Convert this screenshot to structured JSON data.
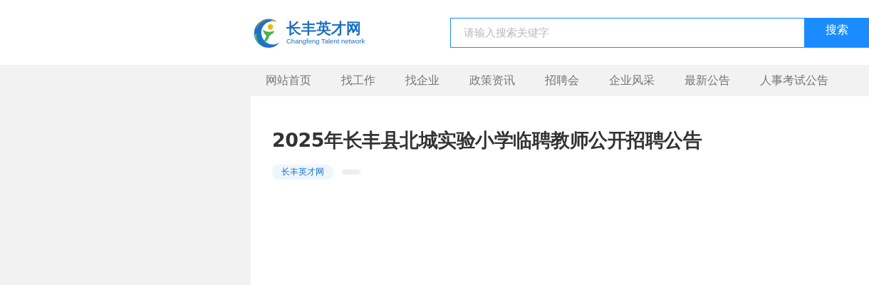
{
  "logo": {
    "name": "长丰英才网",
    "tagline": "Changfeng Talent network"
  },
  "search": {
    "placeholder": "请输入搜索关键字",
    "button": "搜索"
  },
  "nav": [
    {
      "label": "网站首页"
    },
    {
      "label": "找工作"
    },
    {
      "label": "找企业"
    },
    {
      "label": "政策资讯"
    },
    {
      "label": "招聘会"
    },
    {
      "label": "企业风采"
    },
    {
      "label": "最新公告"
    },
    {
      "label": "人事考试公告"
    }
  ],
  "article": {
    "title": "2025年长丰县北城实验小学临聘教师公开招聘公告",
    "source": "长丰英才网"
  }
}
